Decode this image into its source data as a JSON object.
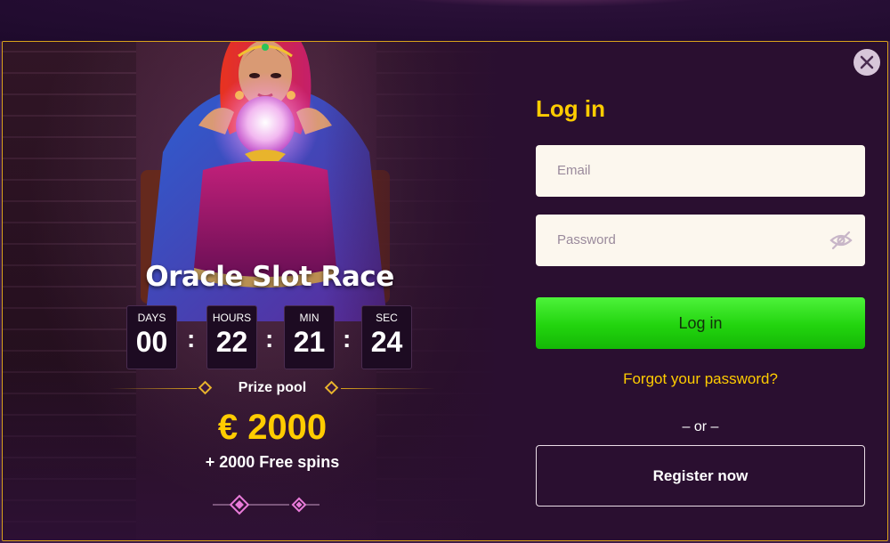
{
  "promo": {
    "title": "Oracle Slot Race",
    "countdown": [
      {
        "label": "DAYS",
        "value": "00"
      },
      {
        "label": "HOURS",
        "value": "22"
      },
      {
        "label": "MIN",
        "value": "21"
      },
      {
        "label": "SEC",
        "value": "24"
      }
    ],
    "separator": ":",
    "prize_label": "Prize pool",
    "prize_amount": "€ 2000",
    "free_spins": "+ 2000 Free spins"
  },
  "login": {
    "title": "Log in",
    "email_placeholder": "Email",
    "password_placeholder": "Password",
    "submit_label": "Log in",
    "forgot_label": "Forgot your password?",
    "or_label": "– or –",
    "register_label": "Register now"
  },
  "icons": {
    "close": "close-icon",
    "password_visibility": "eye-slash-icon"
  },
  "colors": {
    "accent_yellow": "#ffcc00",
    "login_green": "#22d40e",
    "modal_bg": "#2a0f30",
    "border_gold": "#d9a21b",
    "input_bg": "#fcf7ee"
  }
}
